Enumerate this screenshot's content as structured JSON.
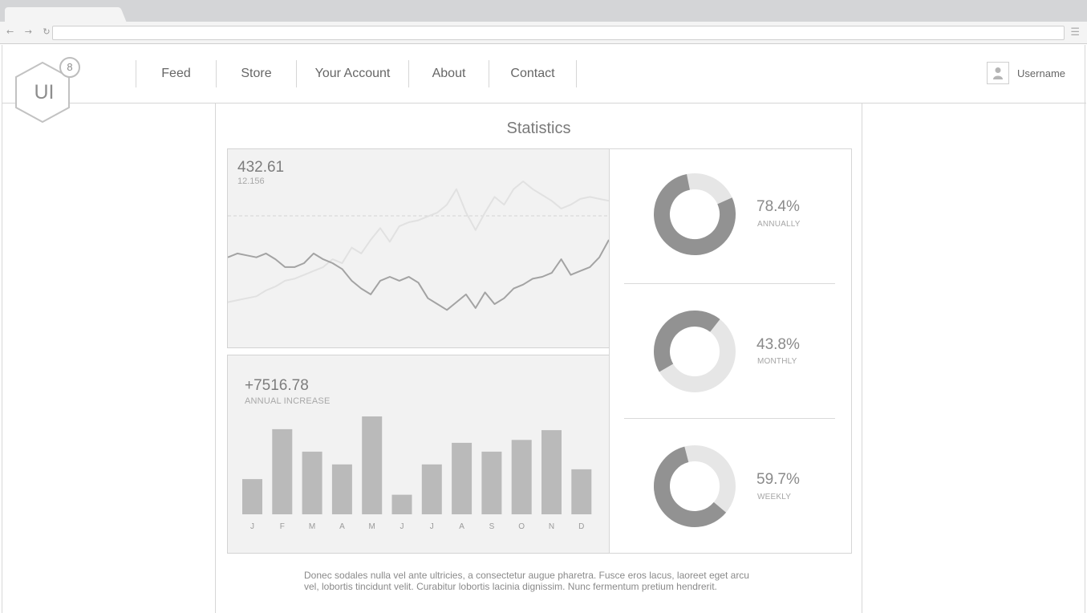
{
  "browser": {
    "nav_arrows": "← → ↻",
    "menu_glyph": "☰"
  },
  "header": {
    "logo_text": "UI",
    "logo_badge": "8",
    "nav": [
      "Feed",
      "Store",
      "Your Account",
      "About",
      "Contact"
    ],
    "username": "Username"
  },
  "main": {
    "title": "Statistics",
    "line_panel": {
      "value": "432.61",
      "subvalue": "12.156"
    },
    "bar_panel": {
      "value": "+7516.78",
      "label": "ANNUAL INCREASE"
    },
    "donuts": [
      {
        "percent": "78.4%",
        "label": "ANNUALLY"
      },
      {
        "percent": "43.8%",
        "label": "MONTHLY"
      },
      {
        "percent": "59.7%",
        "label": "WEEKLY"
      }
    ],
    "paragraph": "Donec sodales nulla vel ante ultricies, a consectetur augue pharetra. Fusce eros lacus, laoreet eget arcu vel, lobortis tincidunt velit. Curabitur lobortis lacinia dignissim. Nunc fermentum pretium hendrerit."
  },
  "chart_data": [
    {
      "type": "line",
      "x": [
        0,
        1,
        2,
        3,
        4,
        5,
        6,
        7,
        8,
        9,
        10,
        11,
        12,
        13,
        14,
        15,
        16,
        17,
        18,
        19,
        20,
        21,
        22,
        23,
        24,
        25,
        26,
        27,
        28,
        29,
        30,
        31,
        32,
        33,
        34,
        35,
        36,
        37,
        38,
        39,
        40
      ],
      "series": [
        {
          "values": [
            31,
            33,
            32,
            31,
            33,
            30,
            26,
            26,
            28,
            33,
            30,
            28,
            25,
            19,
            15,
            12,
            19,
            21,
            19,
            21,
            18,
            10,
            7,
            4,
            8,
            12,
            5,
            13,
            7,
            10,
            15,
            17,
            20,
            21,
            23,
            30,
            22,
            24,
            26,
            31,
            40
          ]
        },
        {
          "values": [
            8,
            9,
            10,
            11,
            14,
            16,
            19,
            20,
            22,
            24,
            26,
            30,
            28,
            36,
            33,
            40,
            46,
            39,
            47,
            49,
            50,
            52,
            54,
            58,
            66,
            54,
            45,
            54,
            62,
            58,
            66,
            70,
            66,
            63,
            60,
            56,
            58,
            61,
            62,
            61,
            60
          ]
        }
      ]
    },
    {
      "type": "bar",
      "categories": [
        "J",
        "F",
        "M",
        "A",
        "M",
        "J",
        "J",
        "A",
        "S",
        "O",
        "N",
        "D"
      ],
      "values": [
        36,
        87,
        64,
        51,
        100,
        20,
        51,
        73,
        64,
        76,
        86,
        46
      ]
    }
  ],
  "colors": {
    "donut_dark": "#929292",
    "donut_light": "#e6e6e6",
    "bar": "#bababa",
    "line_dark": "#a3a3a3",
    "line_light": "#e1e1e1"
  }
}
